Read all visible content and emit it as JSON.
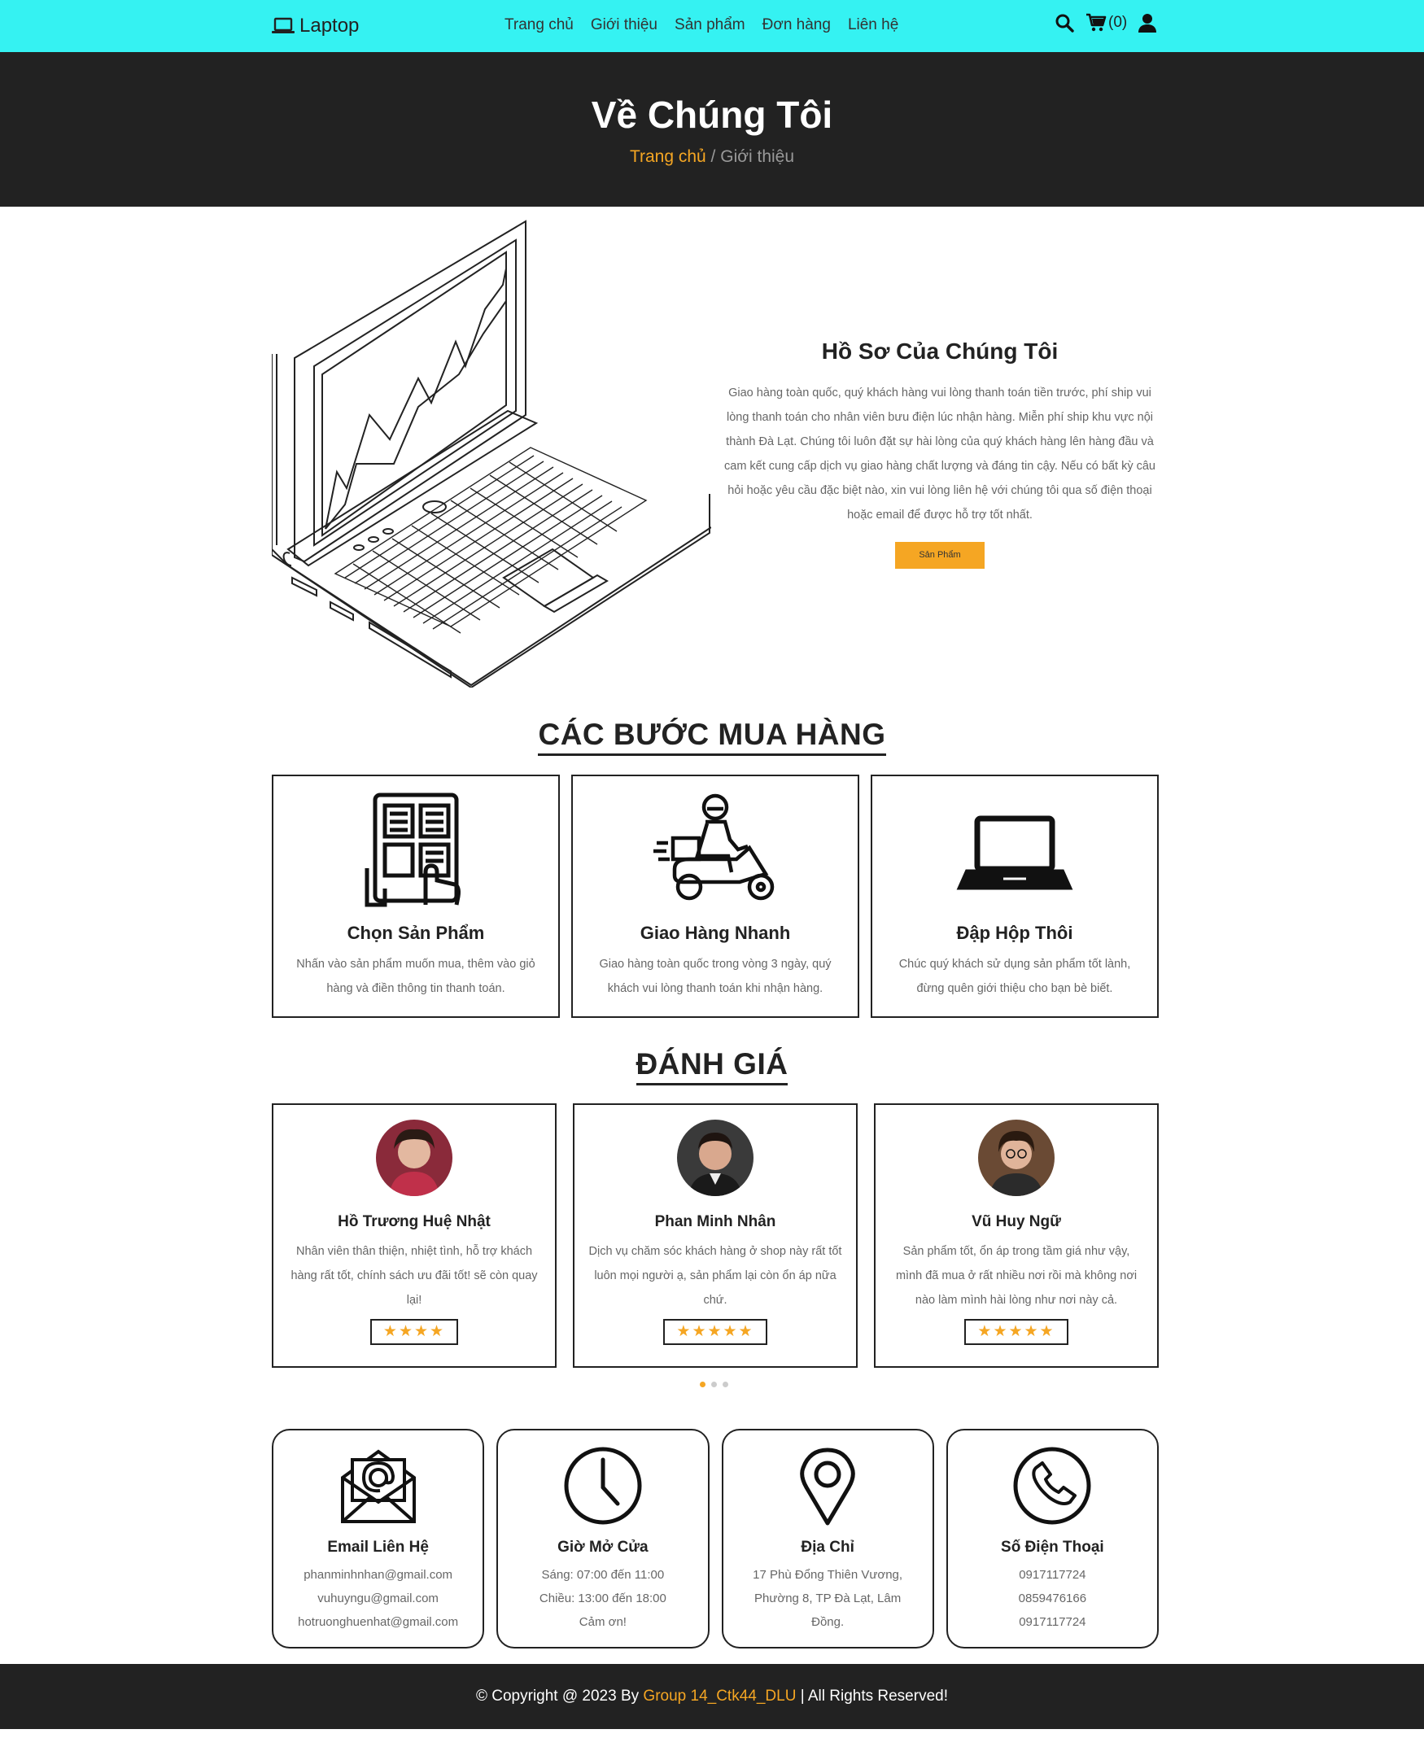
{
  "nav": {
    "brand": "Laptop",
    "links": [
      "Trang chủ",
      "Giới thiệu",
      "Sản phẩm",
      "Đơn hàng",
      "Liên hệ"
    ],
    "cart_count": "(0)"
  },
  "banner": {
    "title": "Về Chúng Tôi",
    "breadcrumb_home": "Trang chủ",
    "breadcrumb_sep": " / ",
    "breadcrumb_current": "Giới thiệu"
  },
  "about": {
    "title": "Hồ Sơ Của Chúng Tôi",
    "description": "Giao hàng toàn quốc, quý khách hàng vui lòng thanh toán tiền trước, phí ship vui lòng thanh toán cho nhân viên bưu điện lúc nhận hàng. Miễn phí ship khu vực nội thành Đà Lạt. Chúng tôi luôn đặt sự hài lòng của quý khách hàng lên hàng đầu và cam kết cung cấp dịch vụ giao hàng chất lượng và đáng tin cậy. Nếu có bất kỳ câu hỏi hoặc yêu cầu đặc biệt nào, xin vui lòng liên hệ với chúng tôi qua số điện thoại hoặc email để được hỗ trợ tốt nhất.",
    "button": "Sản Phẩm"
  },
  "steps": {
    "title": "CÁC BƯỚC MUA HÀNG",
    "items": [
      {
        "title": "Chọn Sản Phẩm",
        "desc": "Nhấn vào sản phẩm muốn mua, thêm vào giỏ hàng và điền thông tin thanh toán.",
        "icon": "catalog-select-icon"
      },
      {
        "title": "Giao Hàng Nhanh",
        "desc": "Giao hàng toàn quốc trong vòng 3 ngày, quý khách vui lòng thanh toán khi nhận hàng.",
        "icon": "delivery-scooter-icon"
      },
      {
        "title": "Đập Hộp Thôi",
        "desc": "Chúc quý khách sử dụng sản phẩm tốt lành, đừng quên giới thiệu cho bạn bè biết.",
        "icon": "laptop-icon"
      }
    ]
  },
  "reviews": {
    "title": "ĐÁNH GIÁ",
    "items": [
      {
        "name": "Hồ Trương Huệ Nhật",
        "text": "Nhân viên thân thiện, nhiệt tình, hỗ trợ khách hàng rất tốt, chính sách ưu đãi tốt! sẽ còn quay lại!",
        "stars": "★★★★",
        "rating": 4
      },
      {
        "name": "Phan Minh Nhân",
        "text": "Dịch vụ chăm sóc khách hàng ở shop này rất tốt luôn mọi người ạ, sản phẩm lại còn ổn áp nữa chứ.",
        "stars": "★★★★★",
        "rating": 5
      },
      {
        "name": "Vũ Huy Ngữ",
        "text": "Sản phẩm tốt, ổn áp trong tầm giá như vậy, mình đã mua ở rất nhiều nơi rồi mà không nơi nào làm mình hài lòng như nơi này cả.",
        "stars": "★★★★★",
        "rating": 5
      }
    ]
  },
  "contacts": [
    {
      "title": "Email Liên Hệ",
      "lines": [
        "phanminhnhan@gmail.com",
        "vuhuyngu@gmail.com",
        "hotruonghuenhat@gmail.com"
      ],
      "icon": "email-icon"
    },
    {
      "title": "Giờ Mở Cửa",
      "lines": [
        "Sáng: 07:00 đến 11:00",
        "Chiều: 13:00 đến 18:00",
        "Cảm ơn!"
      ],
      "icon": "clock-icon"
    },
    {
      "title": "Địa Chỉ",
      "lines": [
        "17 Phù Đổng Thiên Vương,",
        "Phường 8, TP Đà Lạt, Lâm",
        "Đồng."
      ],
      "icon": "location-pin-icon"
    },
    {
      "title": "Số Điện Thoại",
      "lines": [
        "0917117724",
        "0859476166",
        "0917117724"
      ],
      "icon": "phone-icon"
    }
  ],
  "footer": {
    "prefix": "© Copyright @ 2023 By ",
    "group": "Group 14_Ctk44_DLU",
    "suffix": " | All Rights Reserved!"
  },
  "colors": {
    "navbar": "#35f2f2",
    "accent": "#f5a623",
    "dark": "#222222"
  }
}
